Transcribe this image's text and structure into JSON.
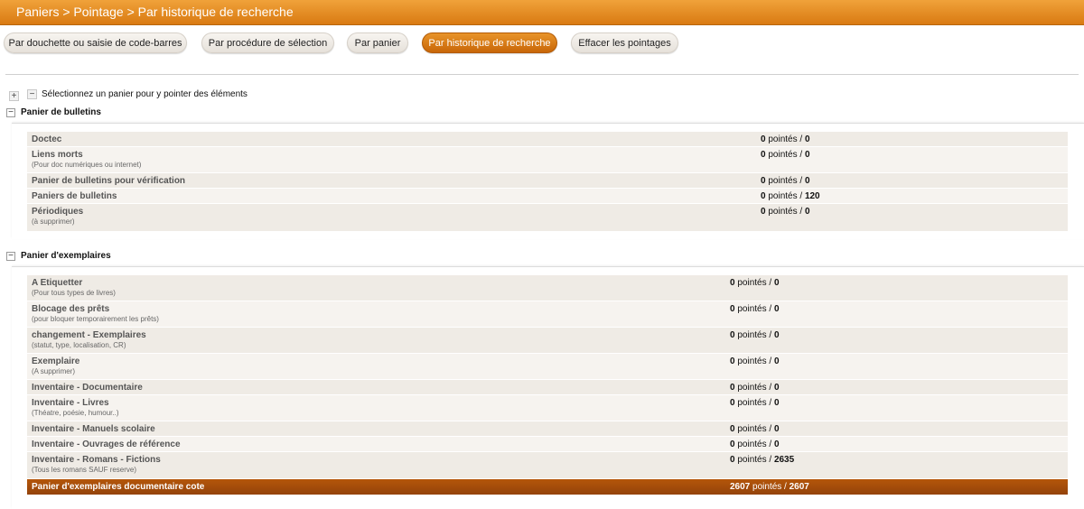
{
  "breadcrumb": "Paniers > Pointage > Par historique de recherche",
  "tabs": [
    "Par douchette ou saisie de code-barres",
    "Par procédure de sélection",
    "Par panier",
    "Par historique de recherche",
    "Effacer les pointages"
  ],
  "hint": "Sélectionnez un panier pour y pointer des éléments",
  "toggles": {
    "expand": "+",
    "collapse": "−"
  },
  "count_sep": "pointés /",
  "sections": [
    {
      "title": "Panier de bulletins",
      "rows": [
        {
          "name": "Doctec",
          "sub": "",
          "points": "0",
          "total": "0"
        },
        {
          "name": "Liens morts",
          "sub": "(Pour doc numériques ou internet)",
          "points": "0",
          "total": "0"
        },
        {
          "name": "Panier de bulletins pour vérification",
          "sub": "",
          "points": "0",
          "total": "0"
        },
        {
          "name": "Paniers de bulletins",
          "sub": "",
          "points": "0",
          "total": "120"
        },
        {
          "name": "Périodiques",
          "sub": "(à supprimer)",
          "points": "0",
          "total": "0"
        }
      ]
    },
    {
      "title": "Panier d'exemplaires",
      "rows": [
        {
          "name": "A Etiquetter",
          "sub": "(Pour tous types de livres)",
          "points": "0",
          "total": "0"
        },
        {
          "name": "Blocage des prêts",
          "sub": "(pour bloquer temporairement les prêts)",
          "points": "0",
          "total": "0"
        },
        {
          "name": "changement - Exemplaires",
          "sub": "(statut, type, localisation, CR)",
          "points": "0",
          "total": "0"
        },
        {
          "name": "Exemplaire",
          "sub": "(A supprimer)",
          "points": "0",
          "total": "0"
        },
        {
          "name": "Inventaire - Documentaire",
          "sub": "",
          "points": "0",
          "total": "0"
        },
        {
          "name": "Inventaire - Livres",
          "sub": "(Théatre, poésie, humour..)",
          "points": "0",
          "total": "0"
        },
        {
          "name": "Inventaire - Manuels scolaire",
          "sub": "",
          "points": "0",
          "total": "0"
        },
        {
          "name": "Inventaire - Ouvrages de référence",
          "sub": "",
          "points": "0",
          "total": "0"
        },
        {
          "name": "Inventaire - Romans - Fictions",
          "sub": "(Tous les romans SAUF reserve)",
          "points": "0",
          "total": "2635"
        },
        {
          "name": "Panier d'exemplaires documentaire cote",
          "sub": "",
          "points": "2607",
          "total": "2607"
        }
      ]
    }
  ],
  "colors": {
    "accent": "#d97a12",
    "selected_row": "#a34d0a"
  }
}
